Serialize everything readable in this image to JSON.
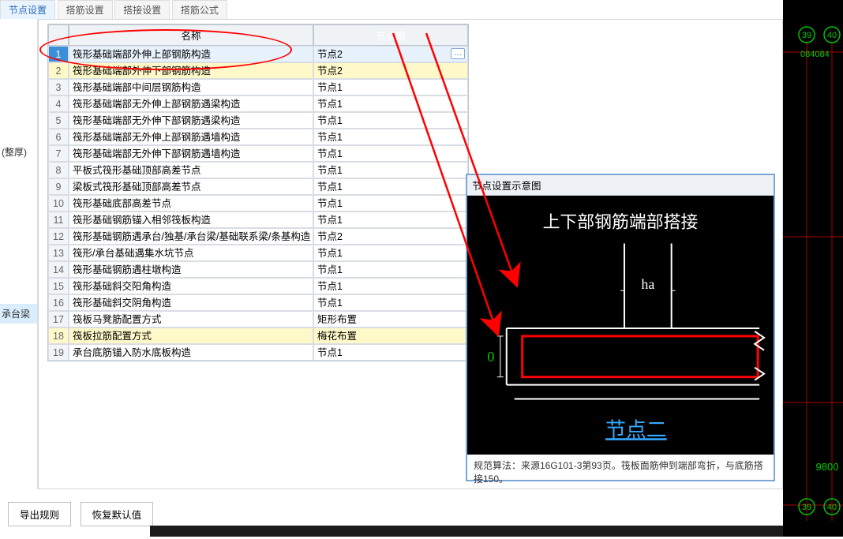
{
  "tabs": [
    "节点设置",
    "搭筋设置",
    "搭接设置",
    "搭筋公式"
  ],
  "active_tab_index": 0,
  "left_strip": {
    "item1": "(整厚)",
    "item2": "承台梁"
  },
  "grid": {
    "headers": {
      "rownum": "",
      "name": "名称",
      "node": "节点图"
    },
    "rows": [
      {
        "n": "1",
        "name": "筏形基础端部外伸上部钢筋构造",
        "node": "节点2",
        "sel": true,
        "hi": false,
        "dots": true
      },
      {
        "n": "2",
        "name": "筏形基础端部外伸下部钢筋构造",
        "node": "节点2",
        "sel": false,
        "hi": true,
        "dots": false
      },
      {
        "n": "3",
        "name": "筏形基础端部中间层钢筋构造",
        "node": "节点1",
        "sel": false,
        "hi": false,
        "dots": false
      },
      {
        "n": "4",
        "name": "筏形基础端部无外伸上部钢筋遇梁构造",
        "node": "节点1",
        "sel": false,
        "hi": false,
        "dots": false
      },
      {
        "n": "5",
        "name": "筏形基础端部无外伸下部钢筋遇梁构造",
        "node": "节点1",
        "sel": false,
        "hi": false,
        "dots": false
      },
      {
        "n": "6",
        "name": "筏形基础端部无外伸上部钢筋遇墙构造",
        "node": "节点1",
        "sel": false,
        "hi": false,
        "dots": false
      },
      {
        "n": "7",
        "name": "筏形基础端部无外伸下部钢筋遇墙构造",
        "node": "节点1",
        "sel": false,
        "hi": false,
        "dots": false
      },
      {
        "n": "8",
        "name": "平板式筏形基础顶部高差节点",
        "node": "节点1",
        "sel": false,
        "hi": false,
        "dots": false
      },
      {
        "n": "9",
        "name": "梁板式筏形基础顶部高差节点",
        "node": "节点1",
        "sel": false,
        "hi": false,
        "dots": false
      },
      {
        "n": "10",
        "name": "筏形基础底部高差节点",
        "node": "节点1",
        "sel": false,
        "hi": false,
        "dots": false
      },
      {
        "n": "11",
        "name": "筏形基础钢筋锚入相邻筏板构造",
        "node": "节点1",
        "sel": false,
        "hi": false,
        "dots": false
      },
      {
        "n": "12",
        "name": "筏形基础钢筋遇承台/独基/承台梁/基础联系梁/条基构造",
        "node": "节点2",
        "sel": false,
        "hi": false,
        "dots": false
      },
      {
        "n": "13",
        "name": "筏形/承台基础遇集水坑节点",
        "node": "节点1",
        "sel": false,
        "hi": false,
        "dots": false
      },
      {
        "n": "14",
        "name": "筏形基础钢筋遇柱墩构造",
        "node": "节点1",
        "sel": false,
        "hi": false,
        "dots": false
      },
      {
        "n": "15",
        "name": "筏形基础斜交阳角构造",
        "node": "节点1",
        "sel": false,
        "hi": false,
        "dots": false
      },
      {
        "n": "16",
        "name": "筏形基础斜交阴角构造",
        "node": "节点1",
        "sel": false,
        "hi": false,
        "dots": false
      },
      {
        "n": "17",
        "name": "筏板马凳筋配置方式",
        "node": "矩形布置",
        "sel": false,
        "hi": false,
        "dots": false
      },
      {
        "n": "18",
        "name": "筏板拉筋配置方式",
        "node": "梅花布置",
        "sel": false,
        "hi": true,
        "dots": false
      },
      {
        "n": "19",
        "name": "承台底筋锚入防水底板构造",
        "node": "节点1",
        "sel": false,
        "hi": false,
        "dots": false
      }
    ]
  },
  "popup": {
    "title": "节点设置示意图",
    "heading": "上下部钢筋端部搭接",
    "dim_label": "ha",
    "zero_label": "0",
    "link_label": "节点二",
    "footer": "规范算法：来源16G101-3第93页。筏板面筋伸到端部弯折，与底筋搭接150。"
  },
  "cad": {
    "labels": [
      "39",
      "40",
      "084084",
      "9800"
    ],
    "bottom_labels": [
      "39",
      "40"
    ]
  },
  "buttons": {
    "export": "导出规则",
    "restore": "恢复默认值"
  }
}
